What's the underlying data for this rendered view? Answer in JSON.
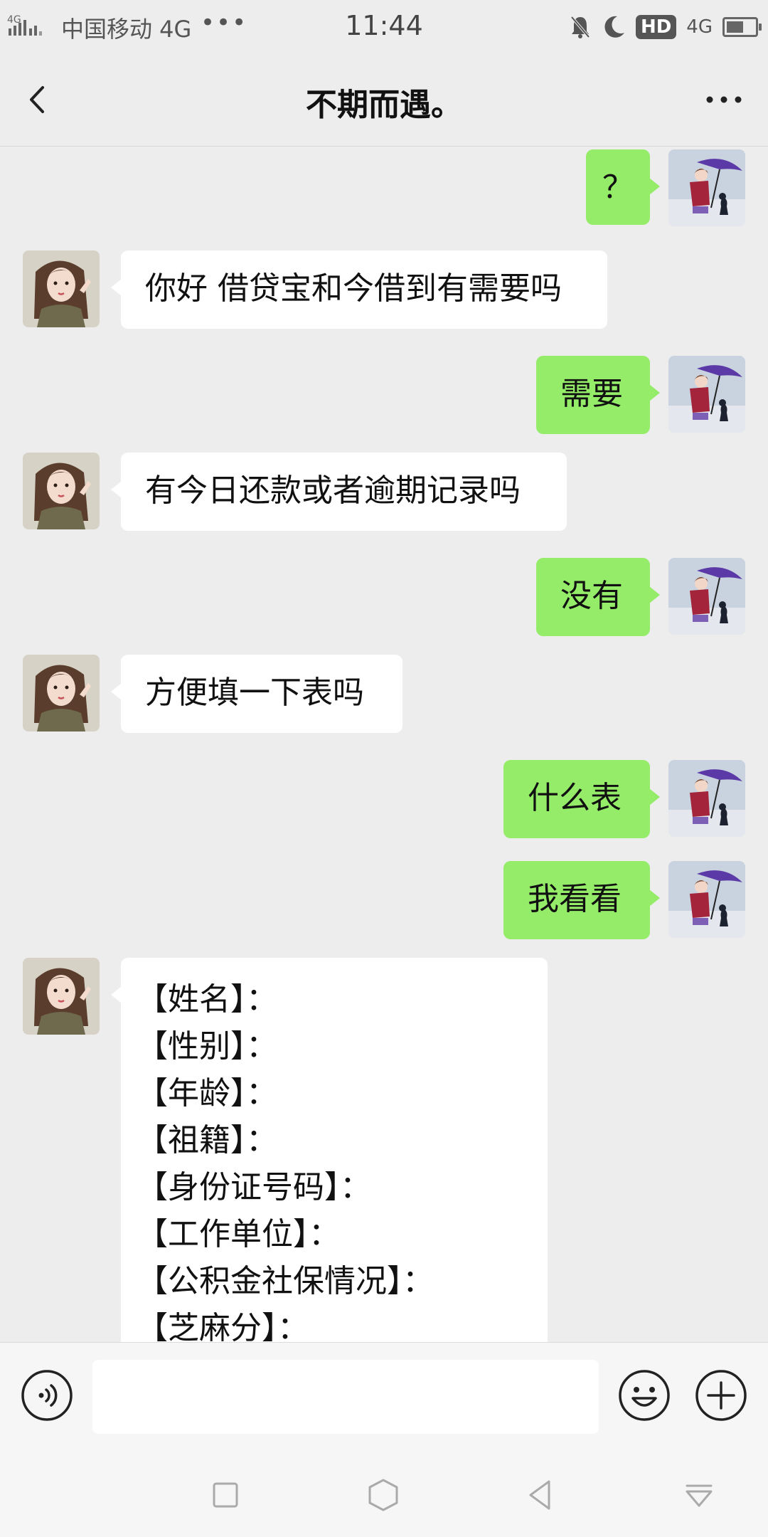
{
  "status_bar": {
    "carrier": "中国移动 4G",
    "more": "•••",
    "time": "11:44",
    "hd": "HD",
    "network": "4G",
    "signal_label": "4G",
    "battery_level": 0.6
  },
  "nav": {
    "title": "不期而遇。"
  },
  "messages": [
    {
      "side": "me",
      "text": "？"
    },
    {
      "side": "other",
      "text": "你好 借贷宝和今借到有需要吗"
    },
    {
      "side": "me",
      "text": "需要"
    },
    {
      "side": "other",
      "text": "有今日还款或者逾期记录吗"
    },
    {
      "side": "me",
      "text": "没有"
    },
    {
      "side": "other",
      "text": "方便填一下表吗"
    },
    {
      "side": "me",
      "text": "什么表"
    },
    {
      "side": "me",
      "text": "我看看"
    },
    {
      "side": "other",
      "lines": [
        "【姓名】：",
        "【性别】：",
        "【年龄】：",
        "【祖籍】：",
        "【身份证号码】：",
        "【工作单位】：",
        "【公积金社保情况】：",
        "【芝麻分】："
      ]
    }
  ],
  "input": {
    "placeholder": "",
    "value": ""
  },
  "icons": {
    "back": "back-chevron-icon",
    "more": "more-dots-icon",
    "voice": "voice-icon",
    "emoji": "emoji-icon",
    "plus": "plus-icon",
    "mute": "bell-mute-icon",
    "moon": "moon-icon"
  },
  "colors": {
    "background": "#ededed",
    "my_bubble": "#95ec69",
    "other_bubble": "#ffffff"
  }
}
